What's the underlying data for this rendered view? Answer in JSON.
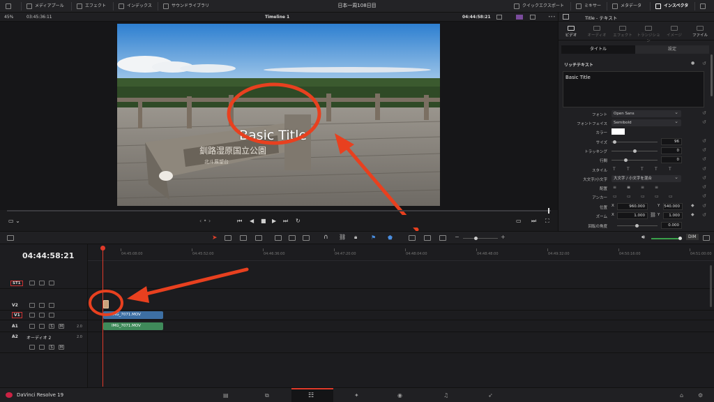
{
  "toolbar": {
    "media_pool": "メディアプール",
    "effects": "エフェクト",
    "index": "インデックス",
    "sound_library": "サウンドライブラリ",
    "project_title": "日本一周108日目",
    "quick_export": "クイックエクスポート",
    "mixer": "ミキサー",
    "metadata": "メタデータ",
    "inspector": "インスペクタ"
  },
  "viewer": {
    "zoom": "45%",
    "source_timecode": "03:45:36:11",
    "timeline_name": "Timeline 1",
    "record_timecode": "04:44:58:21",
    "title_overlay": "Basic Title"
  },
  "inspector": {
    "header": "Title - テキスト",
    "tabs": [
      "ビデオ",
      "オーディオ",
      "エフェクト",
      "トランジション",
      "イメージ",
      "ファイル"
    ],
    "subtabs": [
      "タイトル",
      "設定"
    ],
    "rich_text_label": "リッチテキスト",
    "text_value": "Basic Title",
    "font_label": "フォント",
    "font_value": "Open Sans",
    "font_face_label": "フォントフェイス",
    "font_face_value": "Semibold",
    "color_label": "カラー",
    "color_value": "#ffffff",
    "size_label": "サイズ",
    "size_value": "96",
    "size_fraction": 0.03,
    "tracking_label": "トラッキング",
    "tracking_value": "0",
    "tracking_fraction": 0.5,
    "line_spacing_label": "行間",
    "line_spacing_value": "0",
    "line_spacing_fraction": 0.3,
    "style_label": "スタイル",
    "style_glyphs": [
      "T",
      "T",
      "T",
      "T",
      "T"
    ],
    "case_label": "大文字/小文字",
    "case_value": "大文字 / 小文字を混合",
    "align_label": "配置",
    "anchor_label": "アンカー",
    "position_label": "位置",
    "position_x": "960.000",
    "position_y": "540.000",
    "zoom_label": "ズーム",
    "zoom_x": "1.000",
    "zoom_y": "1.000",
    "rotation_label": "回転の角度",
    "rotation_value": "0.000",
    "x_axis": "X",
    "y_axis": "Y"
  },
  "timeline": {
    "timecode": "04:44:58:21",
    "ruler_ticks": [
      "04:45:08:00",
      "04:45:52:00",
      "04:46:36:00",
      "04:47:20:00",
      "04:48:04:00",
      "04:48:48:00",
      "04:49:32:00",
      "04:50:16:00",
      "04:51:00:00"
    ],
    "dim_label": "DIM",
    "tracks": {
      "st1": "ST1",
      "v2": "V2",
      "v1": "V1",
      "a1": "A1",
      "a1_level": "2.0",
      "a2": "A2",
      "a2_name": "オーディオ 2",
      "a2_level": "2.0"
    },
    "clips": {
      "video_clip": "IMG_7071.MOV",
      "audio_clip": "IMG_7071.MOV"
    },
    "clip_colors": {
      "video": "#3d6fa3",
      "audio": "#3f8a5a",
      "title": "#c9a07a"
    }
  },
  "bottom": {
    "app_name": "DaVinci Resolve 19"
  },
  "annotation_color": "#e8401f"
}
